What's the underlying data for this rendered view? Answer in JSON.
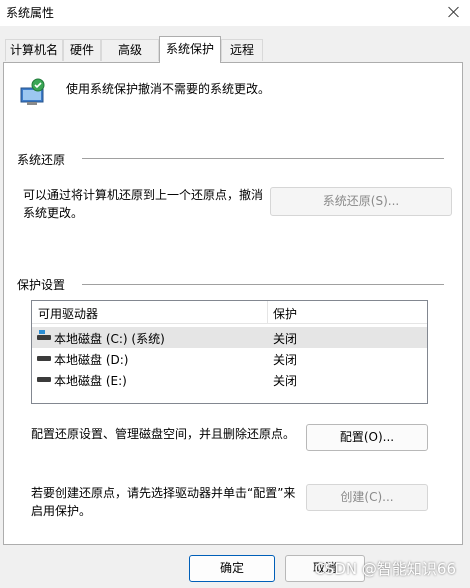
{
  "window": {
    "title": "系统属性"
  },
  "tabs": [
    {
      "label": "计算机名"
    },
    {
      "label": "硬件"
    },
    {
      "label": "高级"
    },
    {
      "label": "系统保护",
      "active": true
    },
    {
      "label": "远程"
    }
  ],
  "intro": {
    "text": "使用系统保护撤消不需要的系统更改。",
    "icon": "system-protection-shield-icon"
  },
  "restore": {
    "section": "系统还原",
    "description_line1": "可以通过将计算机还原到上一个还原点，撤消",
    "description_line2": "系统更改。",
    "button": "系统还原(S)..."
  },
  "protection": {
    "section": "保护设置",
    "columns": [
      "可用驱动器",
      "保护"
    ],
    "drives": [
      {
        "name": "本地磁盘 (C:) (系统)",
        "status": "关闭",
        "icon": "system-drive-icon"
      },
      {
        "name": "本地磁盘 (D:)",
        "status": "关闭",
        "icon": "drive-icon"
      },
      {
        "name": "本地磁盘 (E:)",
        "status": "关闭",
        "icon": "drive-icon"
      }
    ],
    "configure_text": "配置还原设置、管理磁盘空间，并且删除还原点。",
    "configure_button": "配置(O)...",
    "create_text_line1": "若要创建还原点，请先选择驱动器并单击“配置”来",
    "create_text_line2": "启用保护。",
    "create_button": "创建(C)..."
  },
  "footer": {
    "ok": "确定",
    "cancel": "取消"
  },
  "watermark": "CSDN @智能知识66",
  "colors": {
    "accent": "#005fb8",
    "panel": "#ffffff",
    "background": "#f0f0f0"
  }
}
